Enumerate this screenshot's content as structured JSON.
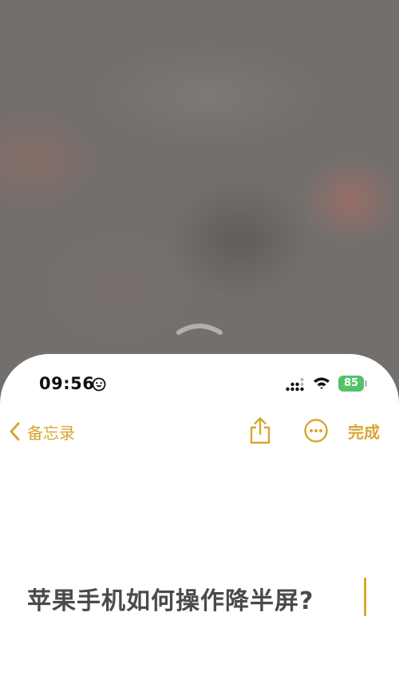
{
  "status_bar": {
    "time": "09:56",
    "battery_level": "85",
    "icons": [
      "smiley-face-icon",
      "signal-icon",
      "wifi-icon",
      "battery-icon"
    ]
  },
  "toolbar": {
    "back_label": "备忘录",
    "share_icon": "share-icon",
    "more_icon": "ellipsis-circle-icon",
    "done_label": "完成"
  },
  "note": {
    "title": "苹果手机如何操作降半屏?"
  },
  "colors": {
    "accent": "#d9a630",
    "battery": "#55c26a",
    "dimmed_background": "#736f6d"
  }
}
